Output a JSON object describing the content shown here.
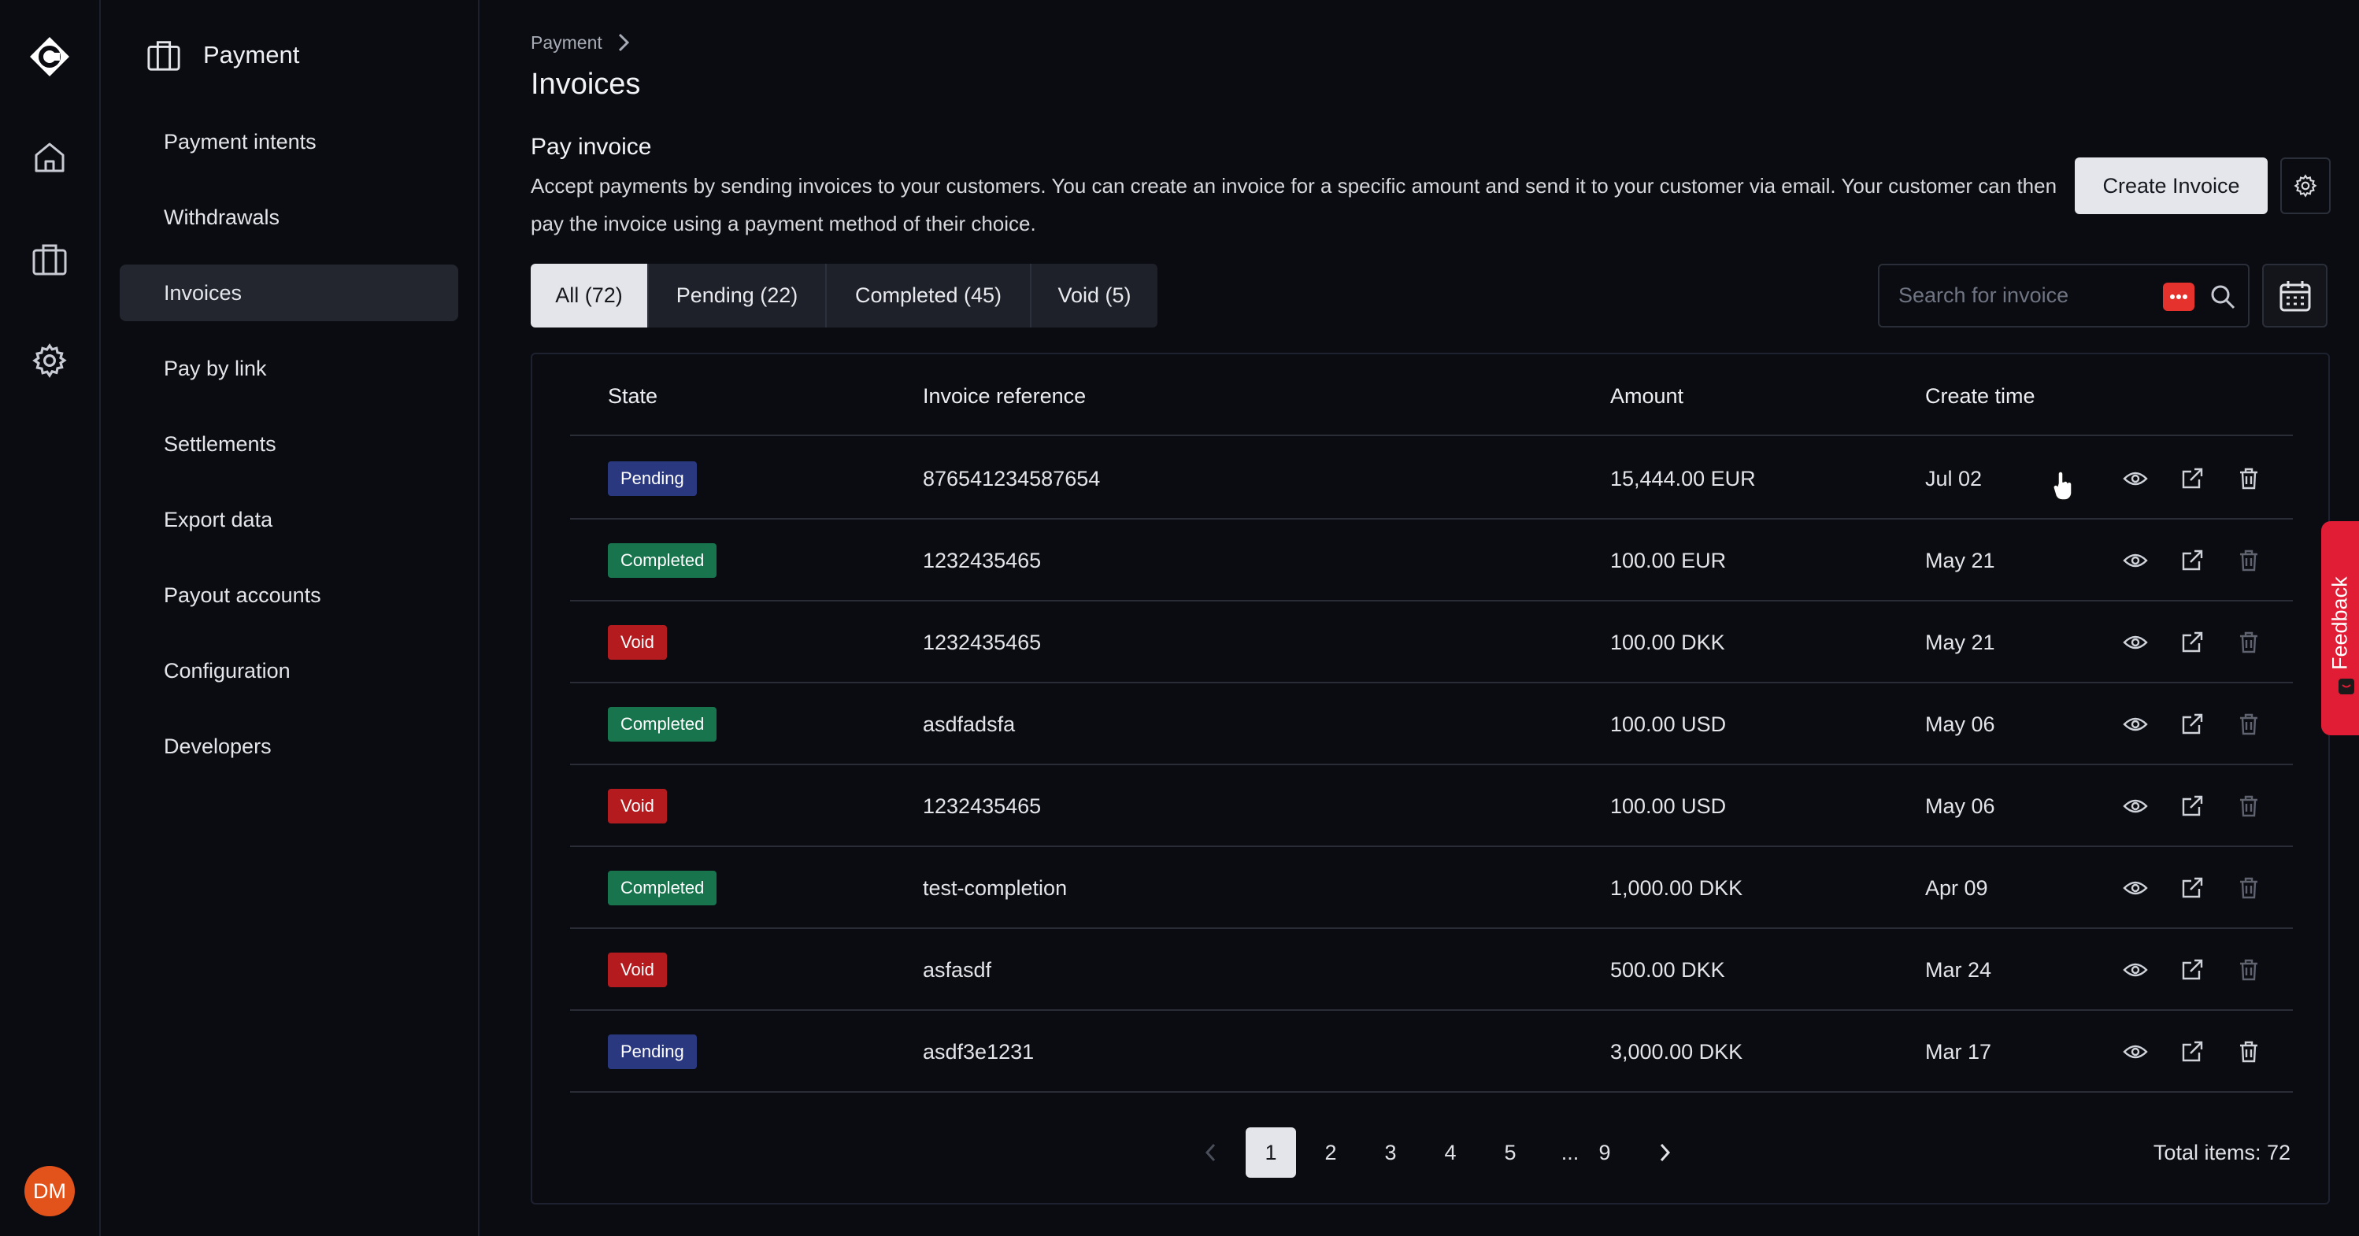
{
  "user": {
    "initials": "DM"
  },
  "rail": {
    "items": [
      "home-icon",
      "briefcase-icon",
      "gear-icon"
    ]
  },
  "sidebar": {
    "title": "Payment",
    "items": [
      {
        "label": "Payment intents"
      },
      {
        "label": "Withdrawals"
      },
      {
        "label": "Invoices",
        "active": true
      },
      {
        "label": "Pay by link"
      },
      {
        "label": "Settlements"
      },
      {
        "label": "Export data"
      },
      {
        "label": "Payout accounts"
      },
      {
        "label": "Configuration"
      },
      {
        "label": "Developers"
      }
    ]
  },
  "breadcrumb": {
    "parent": "Payment"
  },
  "page": {
    "title": "Invoices",
    "section_title": "Pay invoice",
    "section_description": "Accept payments by sending invoices to your customers. You can create an invoice for a specific amount and send it to your customer via email. Your customer can then pay the invoice using a payment method of their choice.",
    "create_button": "Create Invoice"
  },
  "tabs": [
    {
      "label": "All (72)",
      "active": true
    },
    {
      "label": "Pending (22)"
    },
    {
      "label": "Completed (45)"
    },
    {
      "label": "Void (5)"
    }
  ],
  "search": {
    "placeholder": "Search for invoice",
    "value": ""
  },
  "table": {
    "columns": [
      "State",
      "Invoice reference",
      "Amount",
      "Create time"
    ],
    "rows": [
      {
        "state": "Pending",
        "reference": "876541234587654",
        "amount": "15,444.00 EUR",
        "created": "Jul 02"
      },
      {
        "state": "Completed",
        "reference": "1232435465",
        "amount": "100.00 EUR",
        "created": "May 21"
      },
      {
        "state": "Void",
        "reference": "1232435465",
        "amount": "100.00 DKK",
        "created": "May 21"
      },
      {
        "state": "Completed",
        "reference": "asdfadsfa",
        "amount": "100.00 USD",
        "created": "May 06"
      },
      {
        "state": "Void",
        "reference": "1232435465",
        "amount": "100.00 USD",
        "created": "May 06"
      },
      {
        "state": "Completed",
        "reference": "test-completion",
        "amount": "1,000.00 DKK",
        "created": "Apr 09"
      },
      {
        "state": "Void",
        "reference": "asfasdf",
        "amount": "500.00 DKK",
        "created": "Mar 24"
      },
      {
        "state": "Pending",
        "reference": "asdf3e1231",
        "amount": "3,000.00 DKK",
        "created": "Mar 17"
      }
    ]
  },
  "pagination": {
    "pages": [
      "1",
      "2",
      "3",
      "4",
      "5",
      "...",
      "9"
    ],
    "current": "1",
    "total_label": "Total items: 72"
  },
  "feedback": {
    "label": "Feedback"
  },
  "colors": {
    "background": "#0b0c11",
    "pending": "#2a3880",
    "completed": "#17744c",
    "void": "#b31b1f",
    "feedback": "#e11d35",
    "avatar": "#e2521b"
  }
}
